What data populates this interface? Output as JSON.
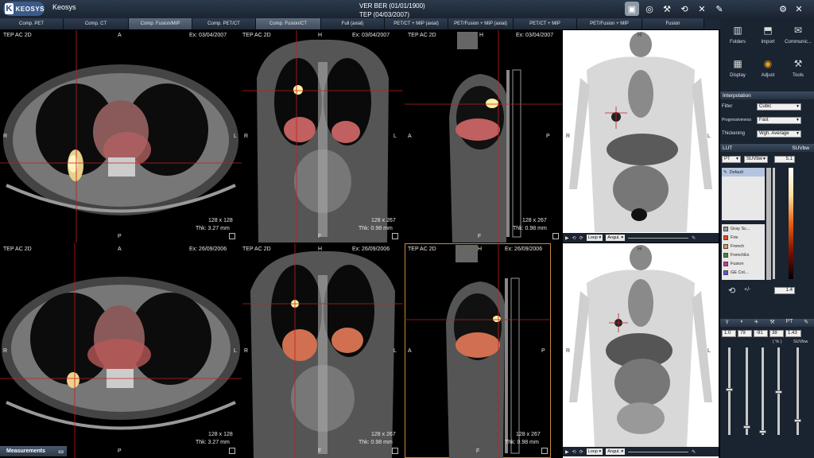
{
  "titlebar": {
    "logo_letter": "K",
    "logo_text": "KEOSYS",
    "app_name": "Keosys",
    "patient_line1": "VER BER  (01/01/1900)",
    "patient_line2": "TEP (04/03/2007)"
  },
  "titlebar_icons": [
    "image-icon",
    "globe-icon",
    "tools-icon",
    "reset-icon",
    "close-icon",
    "pin-icon",
    "gear-icon",
    "close-icon"
  ],
  "tabs": [
    {
      "label": "Comp. PET",
      "active": false
    },
    {
      "label": "Comp. CT",
      "active": false
    },
    {
      "label": "Comp. Fusion/MIP",
      "active": true
    },
    {
      "label": "Comp. PET/CT",
      "active": false
    },
    {
      "label": "Comp. Fusion/CT",
      "active": true
    },
    {
      "label": "Full (axial)",
      "active": false
    },
    {
      "label": "PET/CT + MIP (axial)",
      "active": false
    },
    {
      "label": "PET/Fusion + MIP (axial)",
      "active": false
    },
    {
      "label": "PET/CT + MIP",
      "active": false
    },
    {
      "label": "PET/Fusion + MIP",
      "active": false
    },
    {
      "label": "Fusion",
      "active": false
    }
  ],
  "viewports": {
    "top_axial": {
      "series": "TEP AC 2D",
      "orient_top": "A",
      "date": "Ex: 03/04/2007",
      "left": "R",
      "right": "L",
      "bottom": "P",
      "matrix": "128 x 128",
      "thickness": "Thk: 3.27 mm"
    },
    "top_coronal": {
      "series": "TEP AC 2D",
      "orient_top": "H",
      "date": "Ex: 03/04/2007",
      "left": "R",
      "right": "L",
      "bottom": "F",
      "matrix": "128 x 267",
      "thickness": "Thk: 0.98 mm"
    },
    "top_sagittal": {
      "series": "TEP AC 2D",
      "orient_top": "H",
      "date": "Ex: 03/04/2007",
      "left": "A",
      "right": "P",
      "bottom": "F",
      "matrix": "128 x 267",
      "thickness": "Thk: 0.98 mm"
    },
    "top_mip": {
      "orient_top": "H",
      "left": "R",
      "right": "L",
      "loop": "Loop",
      "angle": "Angul."
    },
    "bot_axial": {
      "series": "TEP AC 2D",
      "orient_top": "A",
      "date": "Ex: 26/09/2006",
      "left": "R",
      "right": "L",
      "bottom": "P",
      "matrix": "128 x 128",
      "thickness": "Thk: 3.27 mm"
    },
    "bot_coronal": {
      "series": "TEP AC 2D",
      "orient_top": "H",
      "date": "Ex: 26/09/2006",
      "left": "R",
      "right": "L",
      "bottom": "F",
      "matrix": "128 x 267",
      "thickness": "Thk: 0.98 mm"
    },
    "bot_sagittal": {
      "series": "TEP AC 2D",
      "orient_top": "H",
      "date": "Ex: 26/09/2006",
      "left": "A",
      "right": "P",
      "bottom": "F",
      "matrix": "128 x 267",
      "thickness": "Thk: 0.98 mm"
    },
    "bot_mip": {
      "orient_top": "H",
      "left": "R",
      "right": "L",
      "loop": "Loop",
      "angle": "Angul."
    }
  },
  "measurements_label": "Measurements",
  "panel": {
    "buttons": [
      {
        "label": "Folders",
        "icon": "folders-icon"
      },
      {
        "label": "Import",
        "icon": "import-icon"
      },
      {
        "label": "Communic...",
        "icon": "communication-icon"
      },
      {
        "label": "Display",
        "icon": "display-icon"
      },
      {
        "label": "Adjust",
        "icon": "adjust-icon"
      },
      {
        "label": "Tools",
        "icon": "tools-icon"
      }
    ],
    "interpolation": {
      "header": "Interpolation",
      "filter_label": "Filter",
      "filter_value": "Cubic",
      "progressiveness_label": "Progressiveness",
      "progressiveness_value": "Fast",
      "thickening_label": "Thickening",
      "thickening_value": "Wgh. Average"
    },
    "lut": {
      "header": "LUT",
      "unit": "SUVbw",
      "modality": "PT",
      "suv_select": "SUVbw",
      "max_value": "5.1",
      "min_value": "1.4",
      "default_label": "Default",
      "reset_label": "reset-icon",
      "plusminus": "+/-",
      "items": [
        {
          "label": "Gray Sc...",
          "color": "#9a9a9a"
        },
        {
          "label": "Fire",
          "color": "#e84a1a"
        },
        {
          "label": "French",
          "color": "#d8a030"
        },
        {
          "label": "FrenchEx",
          "color": "#3a8a3a"
        },
        {
          "label": "Fusion",
          "color": "#c83a8a"
        },
        {
          "label": "GE Col...",
          "color": "#5a5ae0"
        }
      ]
    },
    "wl": {
      "values": [
        "1.0",
        "79",
        "-91",
        "38",
        "1.43"
      ],
      "percent_label": "( % )",
      "suv_label": "SUVbw"
    }
  }
}
